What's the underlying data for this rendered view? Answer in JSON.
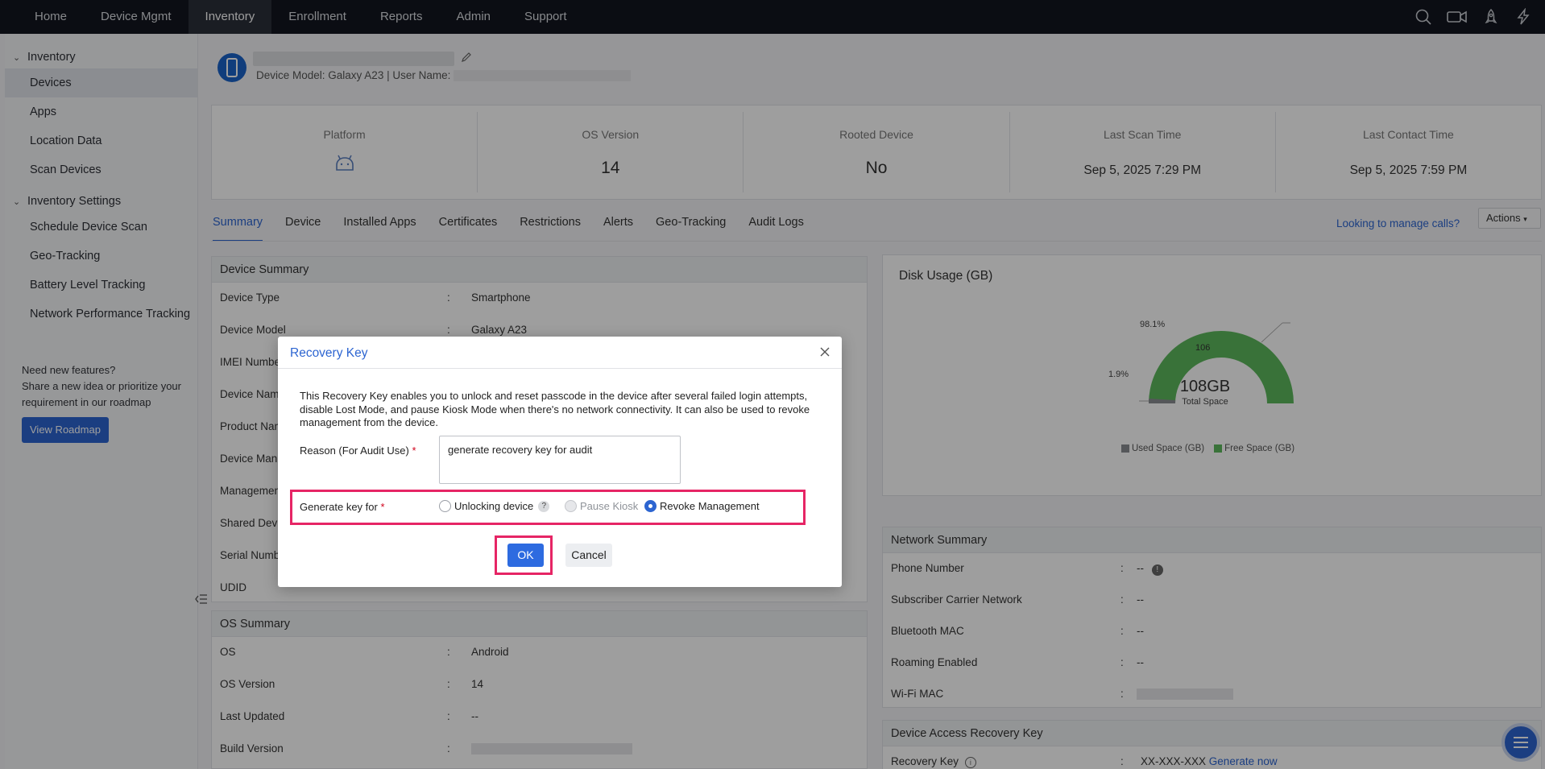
{
  "nav": {
    "items": [
      {
        "label": "Home"
      },
      {
        "label": "Device Mgmt"
      },
      {
        "label": "Inventory"
      },
      {
        "label": "Enrollment"
      },
      {
        "label": "Reports"
      },
      {
        "label": "Admin"
      },
      {
        "label": "Support"
      }
    ],
    "active": "Inventory",
    "icons": [
      "search-icon",
      "video-icon",
      "rocket-icon",
      "bolt-icon"
    ]
  },
  "sidebar": {
    "group1": "Inventory",
    "items1": [
      "Devices",
      "Apps",
      "Location Data",
      "Scan Devices"
    ],
    "group2": "Inventory Settings",
    "items2": [
      "Schedule Device Scan",
      "Geo-Tracking",
      "Battery Level Tracking",
      "Network Performance Tracking"
    ],
    "feature_title": "Need new features?",
    "feature_text": "Share a new idea or prioritize your requirement in our roadmap",
    "roadmap_button": "View Roadmap"
  },
  "device": {
    "subtitle_prefix": "Device Model: Galaxy A23 | User Name:"
  },
  "stats": [
    {
      "label": "Platform",
      "icon": "android-icon"
    },
    {
      "label": "OS Version",
      "value": "14"
    },
    {
      "label": "Rooted Device",
      "value": "No"
    },
    {
      "label": "Last Scan Time",
      "value": "Sep 5, 2025 7:29 PM"
    },
    {
      "label": "Last Contact Time",
      "value": "Sep 5, 2025 7:59 PM"
    }
  ],
  "tabs": [
    "Summary",
    "Device",
    "Installed Apps",
    "Certificates",
    "Restrictions",
    "Alerts",
    "Geo-Tracking",
    "Audit Logs"
  ],
  "active_tab": "Summary",
  "calls_link": "Looking to manage calls?",
  "actions_button": "Actions",
  "device_summary": {
    "title": "Device Summary",
    "rows": [
      {
        "k": "Device Type",
        "v": "Smartphone"
      },
      {
        "k": "Device Model",
        "v": "Galaxy A23"
      },
      {
        "k": "IMEI Number",
        "v": ""
      },
      {
        "k": "Device Name",
        "v": ""
      },
      {
        "k": "Product Name",
        "v": ""
      },
      {
        "k": "Device Manufacturer",
        "v": ""
      },
      {
        "k": "Management",
        "v": ""
      },
      {
        "k": "Shared Device",
        "v": ""
      },
      {
        "k": "Serial Number",
        "v": ""
      },
      {
        "k": "UDID",
        "v": ""
      }
    ]
  },
  "os_summary": {
    "title": "OS Summary",
    "rows": [
      {
        "k": "OS",
        "v": "Android"
      },
      {
        "k": "OS Version",
        "v": "14"
      },
      {
        "k": "Last Updated",
        "v": "--"
      },
      {
        "k": "Build Version",
        "v": ""
      }
    ]
  },
  "disk": {
    "title": "Disk Usage (GB)",
    "total": "108GB",
    "total_label": "Total Space",
    "used_pct": "1.9%",
    "free_pct": "98.1%",
    "free_value": "106",
    "legend_used": "Used Space (GB)",
    "legend_free": "Free Space (GB)",
    "used_color": "#8a8d92",
    "free_color": "#4caf50"
  },
  "network": {
    "title": "Network Summary",
    "rows": [
      {
        "k": "Phone Number",
        "v": "--"
      },
      {
        "k": "Subscriber Carrier Network",
        "v": "--"
      },
      {
        "k": "Bluetooth MAC",
        "v": "--"
      },
      {
        "k": "Roaming Enabled",
        "v": "--"
      },
      {
        "k": "Wi-Fi MAC",
        "v": ""
      }
    ]
  },
  "recovery_panel": {
    "title": "Device Access Recovery Key",
    "key_label": "Recovery Key",
    "key_value": "XX-XXX-XXX",
    "generate_link": "Generate now"
  },
  "modal": {
    "title": "Recovery Key",
    "description": "This Recovery Key enables you to unlock and reset passcode in the device after several failed login attempts, disable Lost Mode, and pause Kiosk Mode when there's no network connectivity. It can also be used to revoke management from the device.",
    "reason_label": "Reason (For Audit Use)",
    "reason_value": "generate recovery key for audit",
    "generate_label": "Generate key for",
    "options": [
      "Unlocking device",
      "Pause Kiosk",
      "Revoke Management"
    ],
    "selected_option": "Revoke Management",
    "ok": "OK",
    "cancel": "Cancel",
    "required_mark": "*"
  }
}
